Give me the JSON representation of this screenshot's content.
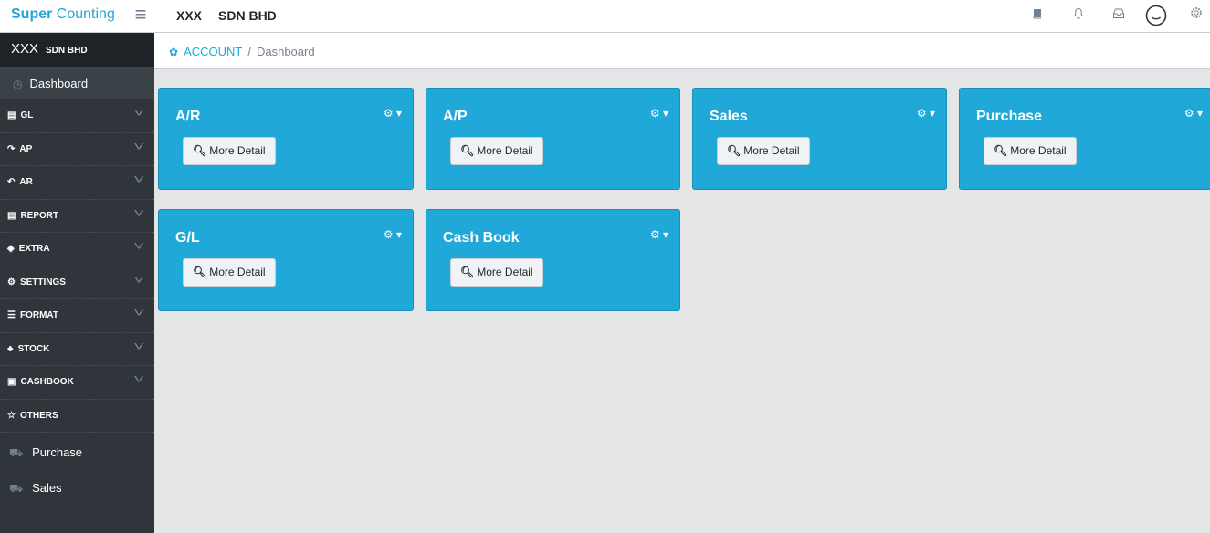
{
  "topbar": {
    "brand_bold": "Super",
    "brand_rest": "Counting",
    "company_a": "XXX",
    "company_b": "SDN BHD",
    "icons": [
      "book-icon",
      "bell-icon",
      "inbox-icon",
      "user-avatar-icon",
      "gear-icon"
    ]
  },
  "sidebar": {
    "header_main": "XXX",
    "header_sub": "SDN BHD",
    "dashboard": "Dashboard",
    "items": [
      {
        "label": "GL",
        "icon": "▤"
      },
      {
        "label": "AP",
        "icon": "↷"
      },
      {
        "label": "AR",
        "icon": "↶"
      },
      {
        "label": "REPORT",
        "icon": "▤"
      },
      {
        "label": "EXTRA",
        "icon": "◈"
      },
      {
        "label": "SETTINGS",
        "icon": "⚙"
      },
      {
        "label": "FORMAT",
        "icon": "☰"
      },
      {
        "label": "STOCK",
        "icon": "♣"
      },
      {
        "label": "CASHBOOK",
        "icon": "▣"
      },
      {
        "label": "OTHERS",
        "icon": "☆"
      }
    ],
    "plain": [
      "Purchase",
      "Sales"
    ]
  },
  "breadcrumb": {
    "root": "ACCOUNT",
    "separator": "/",
    "current": "Dashboard"
  },
  "cards": [
    {
      "title": "A/R",
      "button": "More Detail"
    },
    {
      "title": "A/P",
      "button": "More Detail"
    },
    {
      "title": "Sales",
      "button": "More Detail"
    },
    {
      "title": "Purchase",
      "button": "More Detail"
    },
    {
      "title": "G/L",
      "button": "More Detail"
    },
    {
      "title": "Cash Book",
      "button": "More Detail"
    }
  ],
  "colors": {
    "accent": "#20a8d8",
    "sidebar": "#2f353a",
    "background": "#e4e5e6"
  }
}
